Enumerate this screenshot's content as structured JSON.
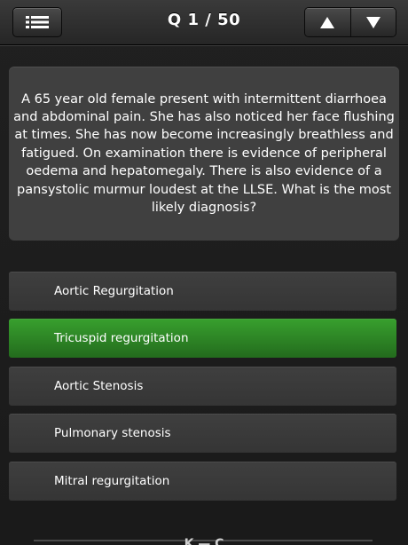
{
  "header": {
    "title": "Q 1 / 50",
    "menu_icon": "list-icon",
    "prev_icon": "up-triangle-icon",
    "next_icon": "down-triangle-icon"
  },
  "question": {
    "text": "A 65 year old female present with intermittent diarrhoea and abdominal pain. She has also noticed her face flushing at times. She has now become increasingly breathless and fatigued. On examination there is evidence of peripheral oedema and hepatomegaly. There is also evidence of a pansystolic murmur loudest at the LLSE. What is the most likely diagnosis?"
  },
  "answers": [
    {
      "label": "Aortic Regurgitation",
      "state": "normal"
    },
    {
      "label": "Tricuspid regurgitation",
      "state": "correct"
    },
    {
      "label": "Aortic Stenosis",
      "state": "normal"
    },
    {
      "label": "Pulmonary stenosis",
      "state": "normal"
    },
    {
      "label": "Mitral regurgitation",
      "state": "normal"
    }
  ],
  "footer": {
    "partial_text": "K — C"
  },
  "colors": {
    "correct": "#2e8b25",
    "answer_bg": "#3a3a3a",
    "card_bg": "#404040"
  }
}
